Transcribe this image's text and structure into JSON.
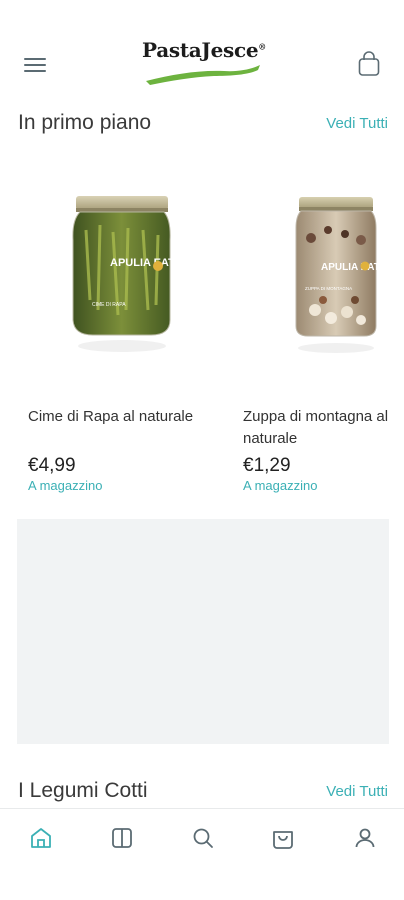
{
  "header": {
    "logo_text": "PastaJesce",
    "logo_mark": "®",
    "menu_icon": "hamburger-menu-icon",
    "cart_icon": "shopping-bag-icon"
  },
  "featured": {
    "title": "In primo piano",
    "see_all": "Vedi Tutti",
    "products": [
      {
        "name": "Cime di Rapa al naturale",
        "price": "€4,99",
        "stock": "A magazzino",
        "jar_brand": "APULIA EAT",
        "jar_label": "CIME DI RAPA"
      },
      {
        "name": "Zuppa di montagna al naturale",
        "price": "€1,29",
        "stock": "A magazzino",
        "jar_brand": "APULIA EAT",
        "jar_label": "ZUPPA DI MONTAGNA"
      }
    ]
  },
  "legumes": {
    "title": "I Legumi Cotti",
    "see_all": "Vedi Tutti"
  },
  "bottom_nav": {
    "items": [
      "home-icon",
      "catalog-book-icon",
      "search-icon",
      "basket-icon",
      "account-icon"
    ],
    "active": "home-icon"
  },
  "colors": {
    "accent": "#3bb0b5",
    "logo_green": "#6db33f",
    "banner_bg": "#f1f3f4"
  }
}
